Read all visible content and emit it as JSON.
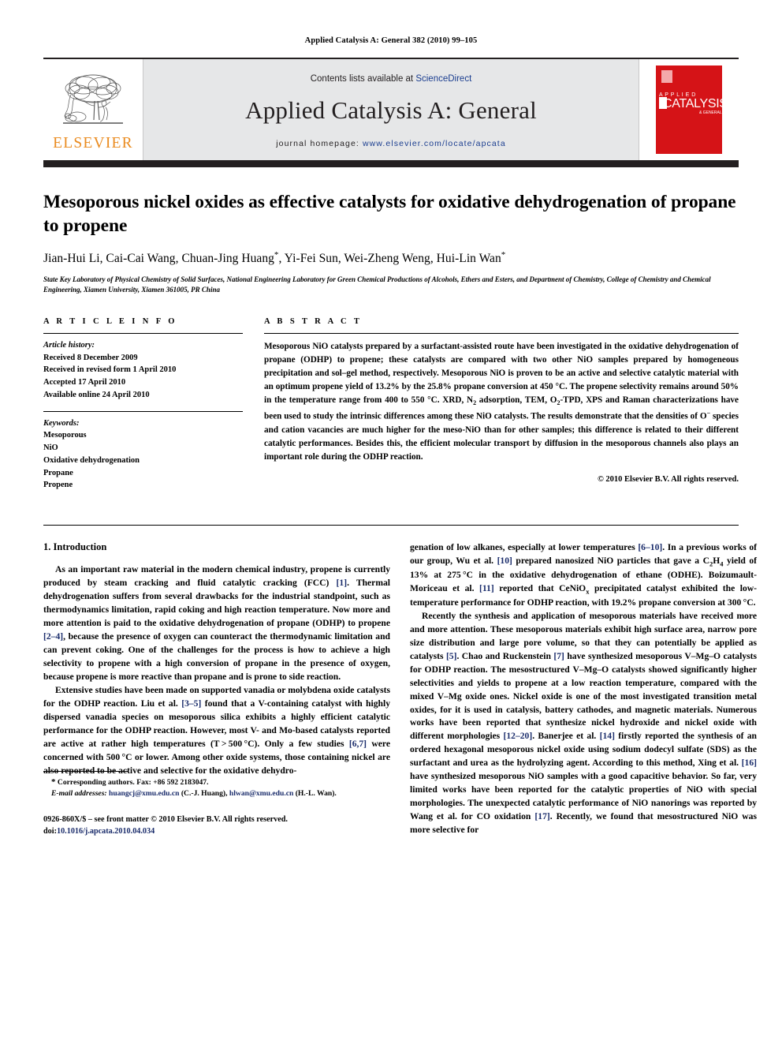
{
  "running_head": "Applied Catalysis A: General 382 (2010) 99–105",
  "masthead": {
    "contents_prefix": "Contents lists available at ",
    "contents_link": "ScienceDirect",
    "journal_title": "Applied Catalysis A: General",
    "homepage_prefix": "journal homepage: ",
    "homepage_url": "www.elsevier.com/locate/apcata",
    "publisher_wordmark": "ELSEVIER",
    "cover": {
      "label_main": "CATALYSIS",
      "label_top": "A P P L I E D",
      "label_sub": "& GENERAL"
    },
    "colors": {
      "band": "#e6e7e8",
      "bar": "#231f20",
      "elsevier_orange": "#ea8b1f",
      "link_blue": "#1a3d8f",
      "cover_red": "#d51317"
    }
  },
  "article": {
    "title": "Mesoporous nickel oxides as effective catalysts for oxidative dehydrogenation of propane to propene",
    "authors_html": "Jian-Hui Li, Cai-Cai Wang, Chuan-Jing Huang<sup>*</sup>, Yi-Fei Sun, Wei-Zheng Weng, Hui-Lin Wan<sup>*</sup>",
    "affiliation": "State Key Laboratory of Physical Chemistry of Solid Surfaces, National Engineering Laboratory for Green Chemical Productions of Alcohols, Ethers and Esters, and Department of Chemistry, College of Chemistry and Chemical Engineering, Xiamen University, Xiamen 361005, PR China"
  },
  "article_info": {
    "heading": "A R T I C L E   I N F O",
    "history_label": "Article history:",
    "history": [
      "Received 8 December 2009",
      "Received in revised form 1 April 2010",
      "Accepted 17 April 2010",
      "Available online 24 April 2010"
    ],
    "keywords_label": "Keywords:",
    "keywords": [
      "Mesoporous",
      "NiO",
      "Oxidative dehydrogenation",
      "Propane",
      "Propene"
    ]
  },
  "abstract": {
    "heading": "A B S T R A C T",
    "text_html": "Mesoporous NiO catalysts prepared by a surfactant-assisted route have been investigated in the oxidative dehydrogenation of propane (ODHP) to propene; these catalysts are compared with two other NiO samples prepared by homogeneous precipitation and sol&ndash;gel method, respectively. Mesoporous NiO is proven to be an active and selective catalytic material with an optimum propene yield of 13.2% by the 25.8% propane conversion at 450 &deg;C. The propene selectivity remains around 50% in the temperature range from 400 to 550 &deg;C. XRD, N<sub>2</sub> adsorption, TEM, O<sub>2</sub>-TPD, XPS and Raman characterizations have been used to study the intrinsic differences among these NiO catalysts. The results demonstrate that the densities of O<sup>&minus;</sup> species and cation vacancies are much higher for the meso-NiO than for other samples; this difference is related to their different catalytic performances. Besides this, the efficient molecular transport by diffusion in the mesoporous channels also plays an important role during the ODHP reaction.",
    "copyright": "© 2010 Elsevier B.V. All rights reserved."
  },
  "body": {
    "section_title": "1.  Introduction",
    "left_paragraphs_html": [
      "As an important raw material in the modern chemical industry, propene is currently produced by steam cracking and fluid catalytic cracking (FCC) <span class=\"ref\">[1]</span>. Thermal dehydrogenation suffers from several drawbacks for the industrial standpoint, such as thermodynamics limitation, rapid coking and high reaction temperature. Now more and more attention is paid to the oxidative dehydrogenation of propane (ODHP) to propene <span class=\"ref\">[2&ndash;4]</span>, because the presence of oxygen can counteract the thermodynamic limitation and can prevent coking. One of the challenges for the process is how to achieve a high selectivity to propene with a high conversion of propane in the presence of oxygen, because propene is more reactive than propane and is prone to side reaction.",
      "Extensive studies have been made on supported vanadia or molybdena oxide catalysts for the ODHP reaction. Liu et al. <span class=\"ref\">[3&ndash;5]</span> found that a V-containing catalyst with highly dispersed vanadia species on mesoporous silica exhibits a highly efficient catalytic performance for the ODHP reaction. However, most V- and Mo-based catalysts reported are active at rather high temperatures (T&thinsp;&gt;&thinsp;500&thinsp;&deg;C). Only a few studies <span class=\"ref\">[6,7]</span> were concerned with 500&thinsp;&deg;C or lower. Among other oxide systems, those containing nickel are also reported to be active and selective for the oxidative dehydro-"
    ],
    "right_paragraphs_html": [
      "genation of low alkanes, especially at lower temperatures <span class=\"ref\">[6&ndash;10]</span>. In a previous works of our group, Wu et al. <span class=\"ref\">[10]</span> prepared nanosized NiO particles that gave a C<sub>2</sub>H<sub>4</sub> yield of 13% at 275&thinsp;&deg;C in the oxidative dehydrogenation of ethane (ODHE). Boizumault-Moriceau et al. <span class=\"ref\">[11]</span> reported that CeNiO<sub>x</sub> precipitated catalyst exhibited the low-temperature performance for ODHP reaction, with 19.2% propane conversion at 300&thinsp;&deg;C.",
      "Recently the synthesis and application of mesoporous materials have received more and more attention. These mesoporous materials exhibit high surface area, narrow pore size distribution and large pore volume, so that they can potentially be applied as catalysts <span class=\"ref\">[5]</span>. Chao and Ruckenstein <span class=\"ref\">[7]</span> have synthesized mesoporous V&ndash;Mg&ndash;O catalysts for ODHP reaction. The mesostructured V&ndash;Mg&ndash;O catalysts showed significantly higher selectivities and yields to propene at a low reaction temperature, compared with the mixed V&ndash;Mg oxide ones. Nickel oxide is one of the most investigated transition metal oxides, for it is used in catalysis, battery cathodes, and magnetic materials. Numerous works have been reported that synthesize nickel hydroxide and nickel oxide with different morphologies <span class=\"ref\">[12&ndash;20]</span>. Banerjee et al. <span class=\"ref\">[14]</span> firstly reported the synthesis of an ordered hexagonal mesoporous nickel oxide using sodium dodecyl sulfate (SDS) as the surfactant and urea as the hydrolyzing agent. According to this method, Xing et al. <span class=\"ref\">[16]</span> have synthesized mesoporous NiO samples with a good capacitive behavior. So far, very limited works have been reported for the catalytic properties of NiO with special morphologies. The unexpected catalytic performance of NiO nanorings was reported by Wang et al. for CO oxidation <span class=\"ref\">[17]</span>. Recently, we found that mesostructured NiO was more selective for"
    ]
  },
  "footnotes": {
    "corresponding_html": "<span style=\"font-size:11px\">*</span> Corresponding authors. Fax: +86 592 2183047.",
    "email_html": "<i>E-mail addresses:</i> <span class=\"email\">huangcj@xmu.edu.cn</span> (C.-J. Huang), <span class=\"email\">hlwan@xmu.edu.cn</span> (H.-L. Wan).",
    "issn_line": "0926-860X/$ – see front matter © 2010 Elsevier B.V. All rights reserved.",
    "doi_prefix": "doi:",
    "doi_value": "10.1016/j.apcata.2010.04.034"
  }
}
